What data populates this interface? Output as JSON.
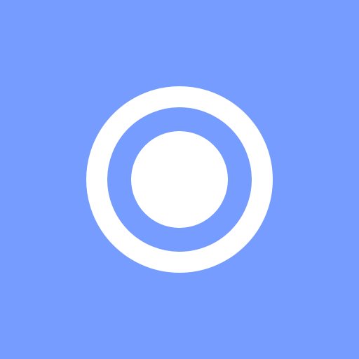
{
  "screen": {
    "background_color": "#769cff",
    "icon": {
      "name": "radio-button-checked-icon",
      "color": "#ffffff"
    }
  }
}
